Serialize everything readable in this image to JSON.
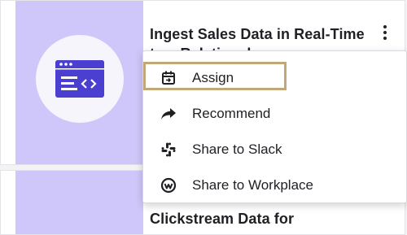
{
  "cards": [
    {
      "title": "Ingest Sales Data in Real-Time to a Relational"
    },
    {
      "title": "Clickstream Data for"
    }
  ],
  "menu": {
    "items": [
      {
        "label": "Assign",
        "icon": "assign-icon"
      },
      {
        "label": "Recommend",
        "icon": "share-arrow-icon"
      },
      {
        "label": "Share to Slack",
        "icon": "slack-icon"
      },
      {
        "label": "Share to Workplace",
        "icon": "workplace-icon"
      }
    ]
  },
  "colors": {
    "thumbnail_bg": "#cfc7f9",
    "icon_purple": "#4b3fd1",
    "highlight_border": "#c2a878"
  }
}
